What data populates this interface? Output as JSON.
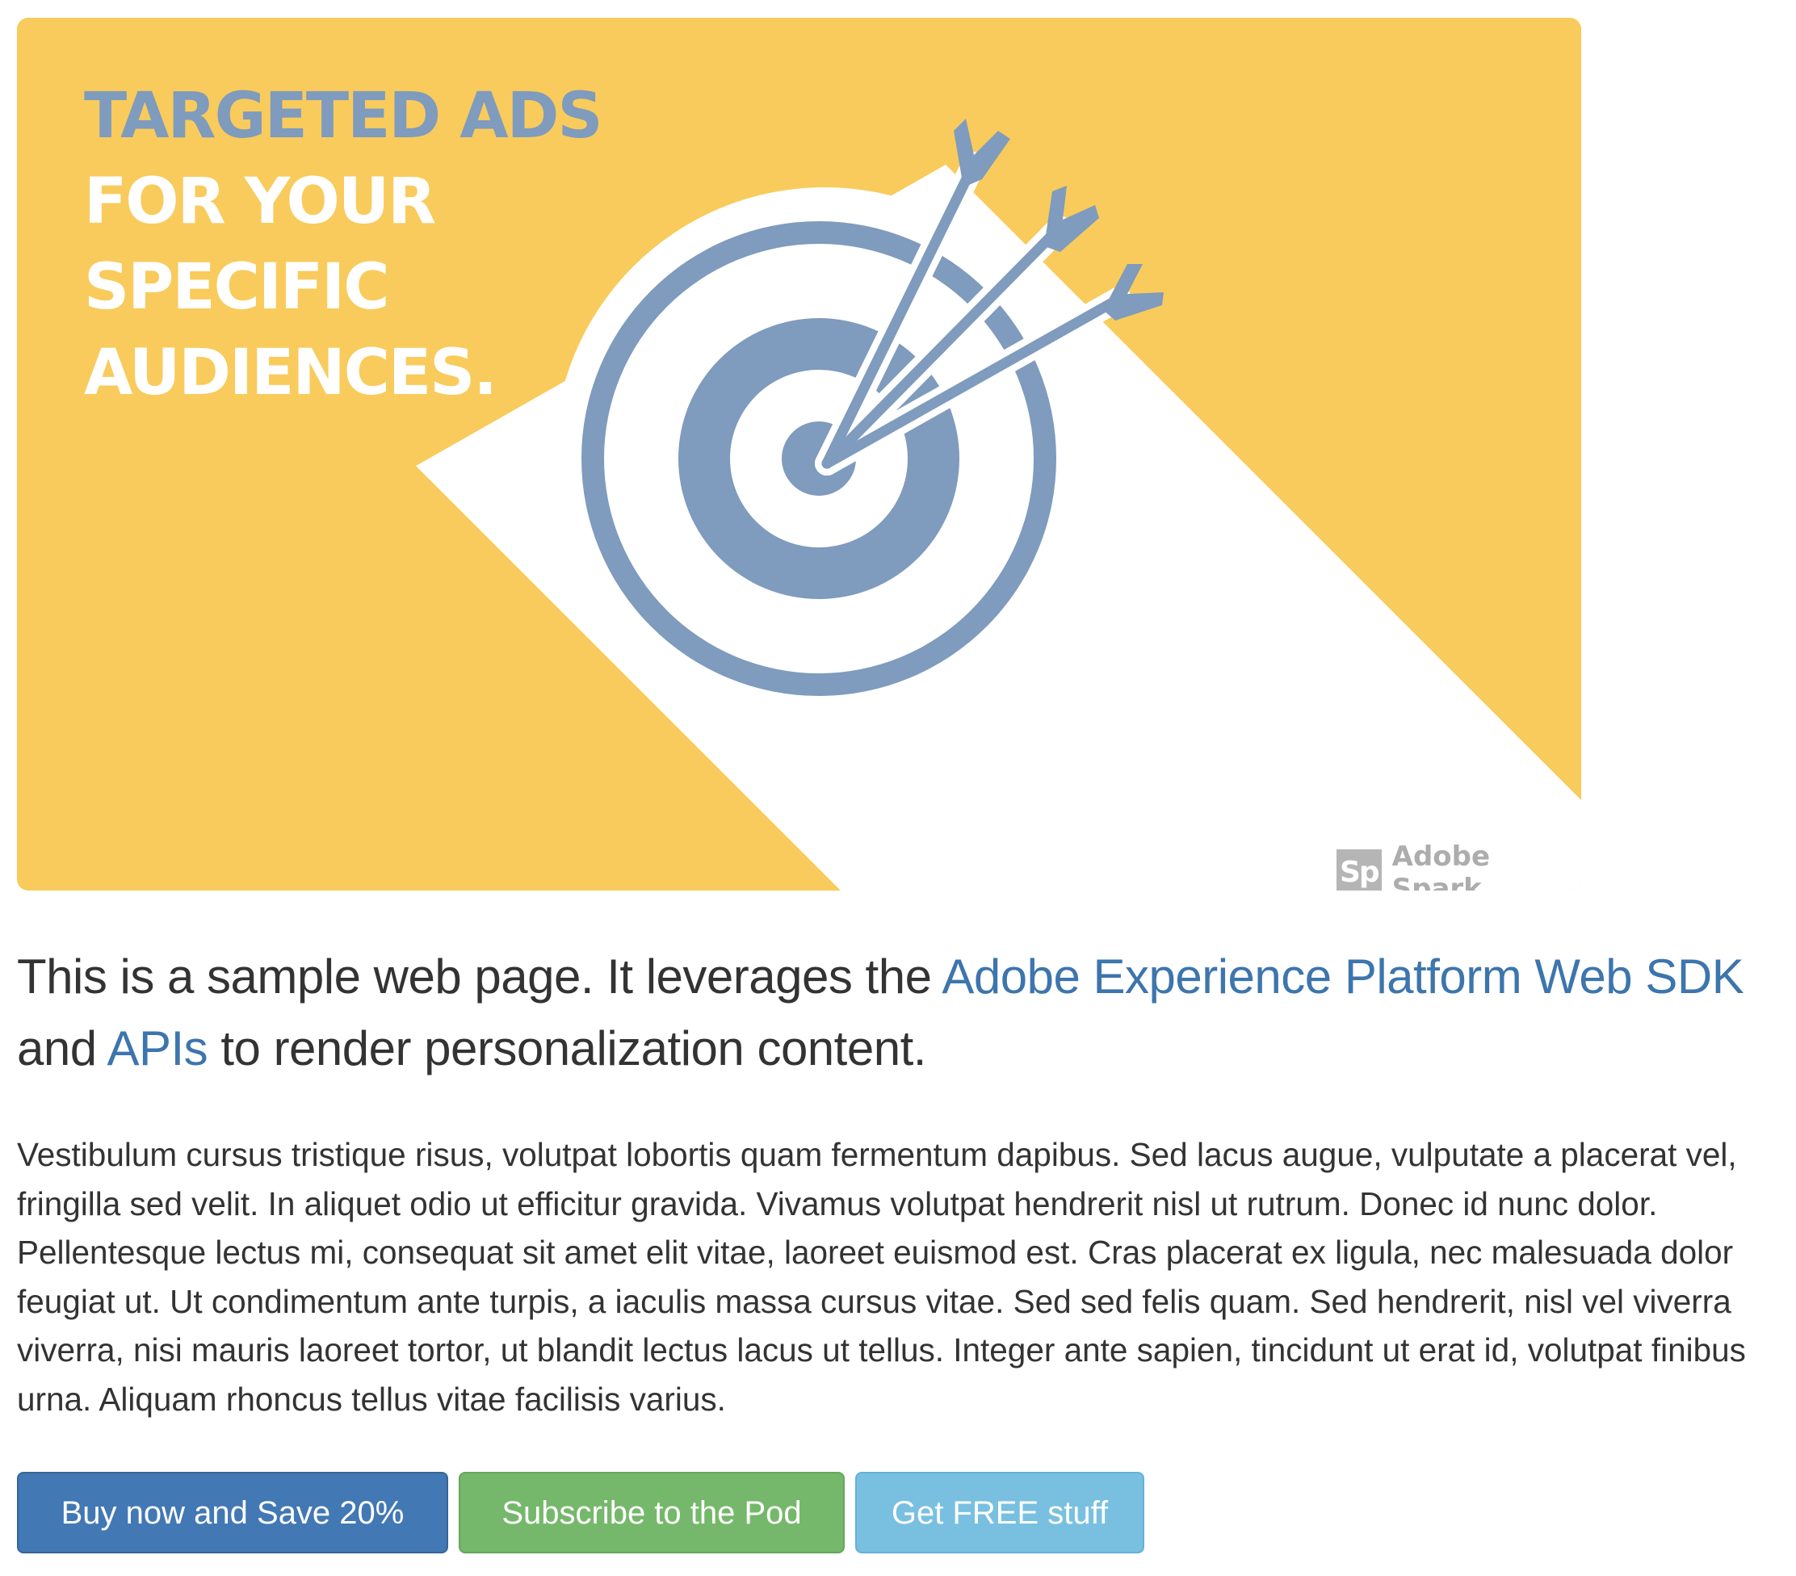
{
  "banner": {
    "title_lines": [
      "TARGETED ADS",
      "FOR YOUR",
      "SPECIFIC",
      "AUDIENCES."
    ],
    "logo_mark": "Sp",
    "logo_text": "Adobe Spark",
    "colors": {
      "background": "#f8cb5c",
      "target": "#7f9bbd",
      "white": "#ffffff"
    }
  },
  "lead": {
    "text_before": "This is a sample web page. It leverages the ",
    "link1": "Adobe Experience Platform Web SDK",
    "text_middle": " and ",
    "link2": "APIs",
    "text_after": " to render personalization content."
  },
  "body_text": "Vestibulum cursus tristique risus, volutpat lobortis quam fermentum dapibus. Sed lacus augue, vulputate a placerat vel, fringilla sed velit. In aliquet odio ut efficitur gravida. Vivamus volutpat hendrerit nisl ut rutrum. Donec id nunc dolor. Pellentesque lectus mi, consequat sit amet elit vitae, laoreet euismod est. Cras placerat ex ligula, nec malesuada dolor feugiat ut. Ut condimentum ante turpis, a iaculis massa cursus vitae. Sed sed felis quam. Sed hendrerit, nisl vel viverra viverra, nisi mauris laoreet tortor, ut blandit lectus lacus ut tellus. Integer ante sapien, tincidunt ut erat id, volutpat finibus urna. Aliquam rhoncus tellus vitae facilisis varius.",
  "buttons": {
    "buy": "Buy now and Save 20%",
    "subscribe": "Subscribe to the Pod",
    "free": "Get FREE stuff"
  },
  "link_color": "#3d75ad"
}
